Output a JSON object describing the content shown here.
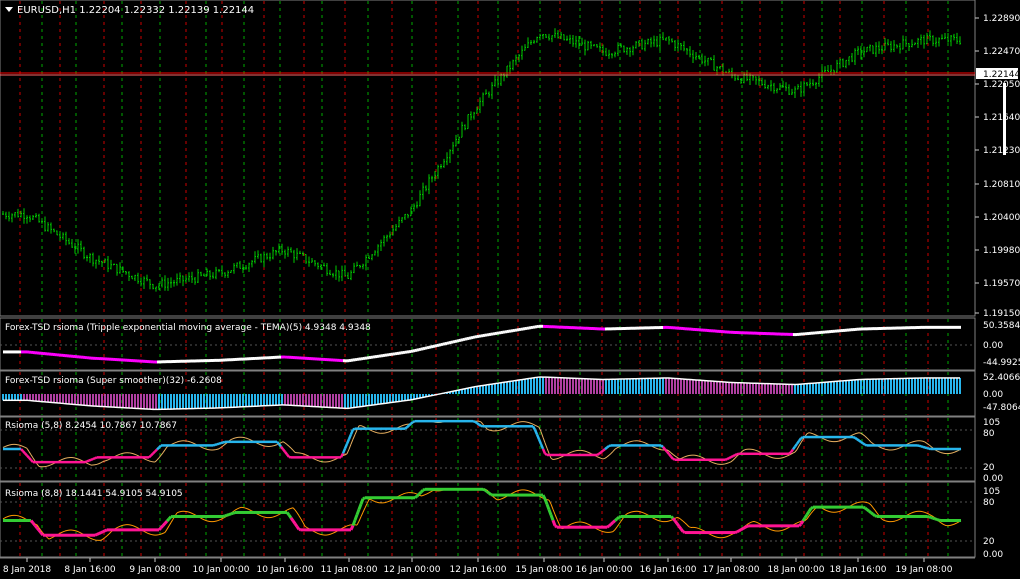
{
  "colors": {
    "background": "#000000",
    "candle": "#00cc00",
    "price_line_current": "#ff0000",
    "bid_label_bg": "#ffffff",
    "separator_up": "#00aa00",
    "separator_down": "#cc0000",
    "tema_up": "#ffffff",
    "tema_down": "#ff00ff",
    "smoother_up_bars": "#27b5ec",
    "smoother_down_bars": "#b03fa2",
    "rsioma_up": "#27b5ec",
    "rsioma_down": "#ff1493",
    "rsioma_signal": "#e8b060",
    "rsioma8_up": "#33cc33",
    "rsioma8_down": "#ff1493",
    "rsioma8_signal": "#ff9900"
  },
  "main": {
    "title": "EURUSD,H1  1.22204 1.22332 1.22139 1.22144",
    "symbol_icon": "triangle-down-icon",
    "current_price": "1.22144",
    "price_ticks": [
      "1.22890",
      "1.22470",
      "1.22050",
      "1.21640",
      "1.21230",
      "1.20810",
      "1.20400",
      "1.19980",
      "1.19570",
      "1.19150"
    ]
  },
  "panes": [
    {
      "label": "Forex-TSD rsioma (Tripple exponential moving average - TEMA)(5) 4.9348 4.9348",
      "scale": [
        "50.3584",
        "0.00",
        "-44.9925"
      ]
    },
    {
      "label": "Forex-TSD rsioma (Super smoother)(32) -6.2608",
      "scale": [
        "52.4066",
        "0.00",
        "-47.8064"
      ]
    },
    {
      "label": "Rsioma (5,8) 8.2454 10.7867 10.7867",
      "scale": [
        "105",
        "80",
        "20",
        "0.00"
      ]
    },
    {
      "label": "Rsioma (8,8) 18.1441 54.9105 54.9105",
      "scale": [
        "105",
        "80",
        "20",
        "0.00"
      ]
    }
  ],
  "time_axis": [
    "8 Jan 2018",
    "8 Jan 16:00",
    "9 Jan 08:00",
    "10 Jan 00:00",
    "10 Jan 16:00",
    "11 Jan 08:00",
    "12 Jan 00:00",
    "12 Jan 16:00",
    "15 Jan 08:00",
    "16 Jan 00:00",
    "16 Jan 16:00",
    "17 Jan 08:00",
    "18 Jan 00:00",
    "18 Jan 16:00",
    "19 Jan 08:00"
  ],
  "chart_data": {
    "type": "candlestick",
    "symbol": "EURUSD",
    "timeframe": "H1",
    "ohlc_last": {
      "open": 1.22204,
      "high": 1.22332,
      "low": 1.22139,
      "close": 1.22144
    },
    "ylim": [
      1.1915,
      1.2289
    ],
    "close_path": {
      "x": [
        "8 Jan 2018",
        "8 Jan 16:00",
        "9 Jan 08:00",
        "10 Jan 00:00",
        "10 Jan 16:00",
        "11 Jan 08:00",
        "12 Jan 00:00",
        "12 Jan 16:00",
        "15 Jan 08:00",
        "16 Jan 00:00",
        "16 Jan 16:00",
        "17 Jan 08:00",
        "18 Jan 00:00",
        "18 Jan 16:00",
        "19 Jan 08:00"
      ],
      "y": [
        1.204,
        1.1985,
        1.195,
        1.1965,
        1.1995,
        1.196,
        1.2045,
        1.2175,
        1.227,
        1.2245,
        1.226,
        1.2215,
        1.2195,
        1.2245,
        1.226
      ]
    }
  }
}
